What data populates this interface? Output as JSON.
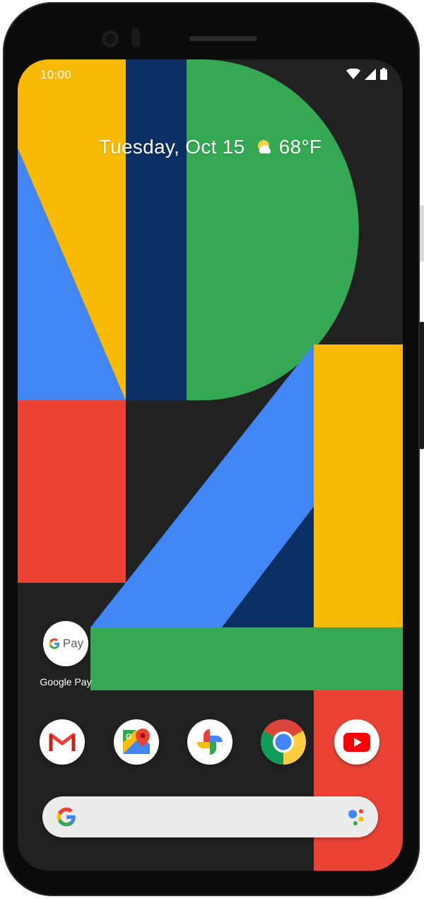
{
  "status_bar": {
    "time": "10:00",
    "icons": [
      "wifi-icon",
      "signal-icon",
      "battery-icon"
    ]
  },
  "at_a_glance": {
    "date": "Tuesday, Oct 15",
    "temperature": "68°F",
    "weather_icon": "partly-sunny-icon"
  },
  "home_apps": [
    {
      "label": "Google Pay",
      "icon": "google-pay-icon",
      "icon_text": "Pay"
    }
  ],
  "dock": [
    {
      "name": "Gmail",
      "icon": "gmail-icon"
    },
    {
      "name": "Maps",
      "icon": "maps-icon"
    },
    {
      "name": "Photos",
      "icon": "photos-icon"
    },
    {
      "name": "Chrome",
      "icon": "chrome-icon"
    },
    {
      "name": "YouTube",
      "icon": "youtube-icon"
    }
  ],
  "search_bar": {
    "logo": "google-g-icon",
    "assistant": "assistant-icon"
  },
  "colors": {
    "blue": "#4285F4",
    "red": "#EA4335",
    "yellow": "#F8BA05",
    "green": "#34A853",
    "navy": "#0B2E63",
    "background": "#212121"
  }
}
